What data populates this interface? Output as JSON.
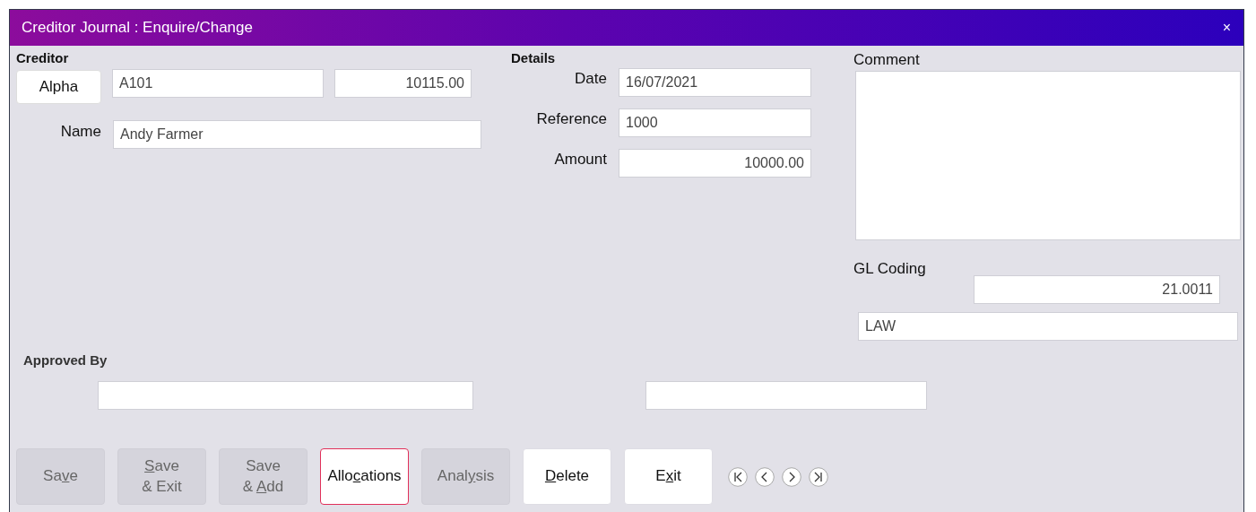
{
  "window": {
    "title": "Creditor Journal : Enquire/Change",
    "close": "×"
  },
  "creditor": {
    "heading": "Creditor",
    "lookup_button": "Alpha",
    "code": "A101",
    "balance": "10115.00",
    "name_label": "Name",
    "name": "Andy Farmer"
  },
  "details": {
    "heading": "Details",
    "fields": [
      {
        "label": "Date",
        "value": "16/07/2021",
        "kind": "text"
      },
      {
        "label": "Reference",
        "value": "1000",
        "kind": "text"
      },
      {
        "label": "Amount",
        "value": "10000.00",
        "kind": "number"
      }
    ]
  },
  "comment": {
    "label": "Comment"
  },
  "gl_coding": {
    "label": "GL Coding",
    "account": "21.0011",
    "description": "LAW"
  },
  "approved_by": {
    "label": "Approved By"
  },
  "buttons": [
    {
      "lines": [
        {
          "pre": "Sa",
          "key": "v",
          "post": "e"
        }
      ],
      "disabled": true,
      "focused": false
    },
    {
      "lines": [
        {
          "key": "S",
          "post": "ave"
        },
        {
          "pre": "& Exit"
        }
      ],
      "disabled": true,
      "focused": false
    },
    {
      "lines": [
        {
          "pre": "Save"
        },
        {
          "pre": "& ",
          "key": "A",
          "post": "dd"
        }
      ],
      "disabled": true,
      "focused": false
    },
    {
      "lines": [
        {
          "pre": "Allo",
          "key": "c",
          "post": "ations"
        }
      ],
      "disabled": false,
      "focused": true
    },
    {
      "lines": [
        {
          "pre": "Anal",
          "key": "y",
          "post": "sis"
        }
      ],
      "disabled": true,
      "focused": false
    },
    {
      "lines": [
        {
          "key": "D",
          "post": "elete"
        }
      ],
      "disabled": false,
      "focused": false
    },
    {
      "lines": [
        {
          "pre": "E",
          "key": "x",
          "post": "it"
        }
      ],
      "disabled": false,
      "focused": false
    }
  ],
  "navigation": [
    {
      "kind": "first"
    },
    {
      "kind": "previous"
    },
    {
      "kind": "next"
    },
    {
      "kind": "last"
    }
  ]
}
